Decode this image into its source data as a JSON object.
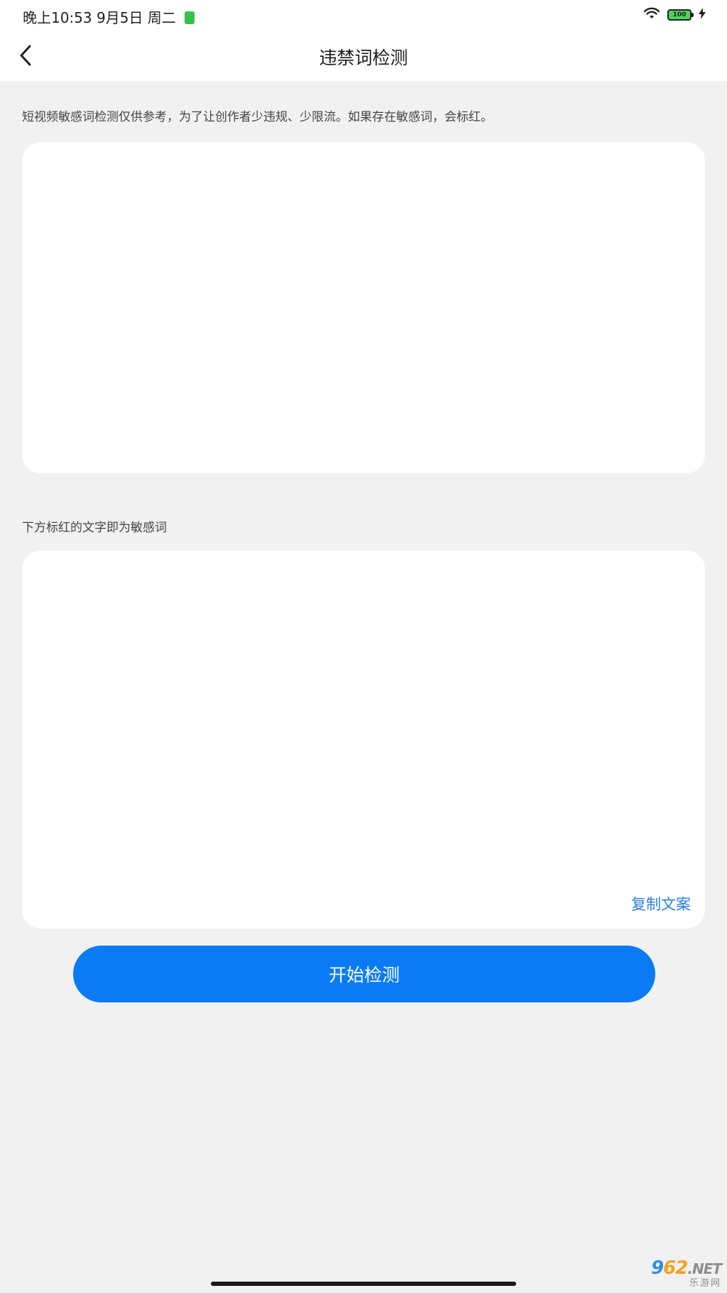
{
  "status_bar": {
    "time": "晚上10:53 9月5日 周二",
    "battery": "100"
  },
  "header": {
    "title": "违禁词检测"
  },
  "input_section": {
    "tip": "短视频敏感词检测仅供参考，为了让创作者少违规、少限流。如果存在敏感词，会标红。",
    "input_value": "",
    "input_placeholder": ""
  },
  "result_section": {
    "label": "下方标红的文字即为敏感词",
    "content": "",
    "copy_label": "复制文案"
  },
  "actions": {
    "start_label": "开始检测"
  },
  "watermark": {
    "num_a": "9",
    "num_b": "62",
    "suffix": ".NET",
    "cn": "乐游网"
  },
  "colors": {
    "accent": "#0a7bf5",
    "link": "#2a7fe0",
    "background": "#f1f1f1",
    "card": "#ffffff"
  }
}
